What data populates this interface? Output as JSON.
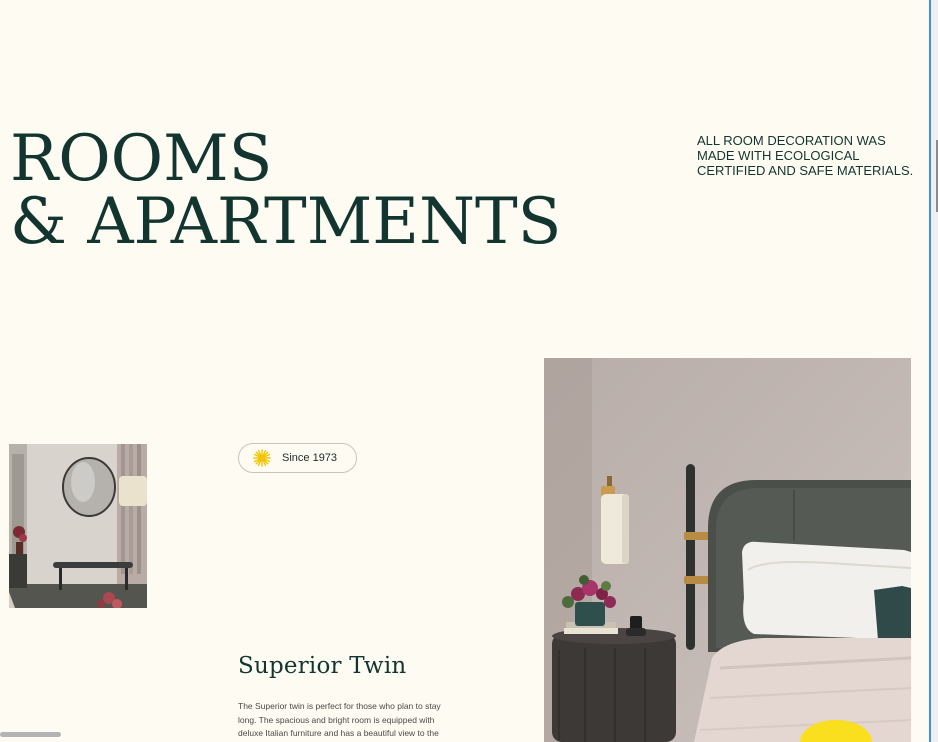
{
  "hero": {
    "line1": "ROOMS",
    "line2": "& APARTMENTS"
  },
  "eco_note": "ALL ROOM DECORATION WAS MADE WITH ECOLOGICAL CERTIFIED AND SAFE MATERIALS.",
  "badge": {
    "icon": "sunburst-icon",
    "label": "Since 1973"
  },
  "room": {
    "title": "Superior Twin",
    "description": "The Superior twin is perfect for those who plan to stay long. The spacious and bright room is equipped with deluxe Italian furniture and has a beautiful view to the"
  },
  "colors": {
    "background": "#FEFBF3",
    "text": "#133530",
    "accent_star": "#F2C400",
    "accent_blob": "#F9DF1E",
    "scroll_line": "#3E8FE6"
  },
  "images": {
    "small": "room-mirror-bench-photo",
    "large": "bedroom-headboard-lamp-photo"
  }
}
